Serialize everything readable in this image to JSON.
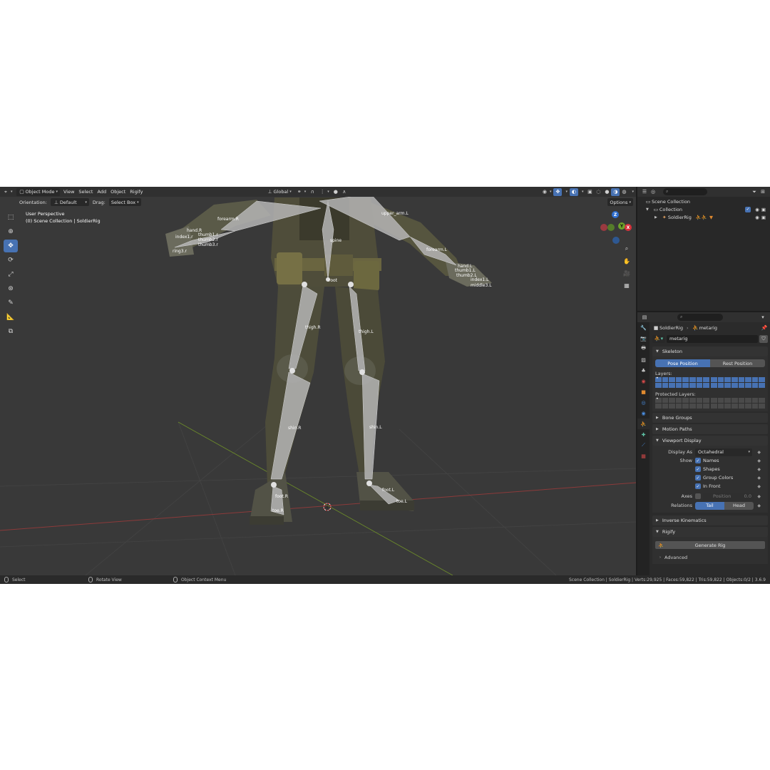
{
  "viewport": {
    "header": {
      "mode": "Object Mode",
      "menus": [
        "View",
        "Select",
        "Add",
        "Object",
        "Rigify"
      ],
      "transform_orientation": "Global"
    },
    "toolrow": {
      "orientation_label": "Orientation:",
      "orientation_value": "Default",
      "drag_label": "Drag:",
      "drag_value": "Select Box",
      "options_label": "Options"
    },
    "overlay": {
      "line1": "User Perspective",
      "line2": "(0) Scene Collection | SoldierRig"
    },
    "gizmo": {
      "z": "Z",
      "y": "Y",
      "x": "X"
    },
    "bone_labels": {
      "forearm_r": "forearm.R",
      "upper_arm_l": "upper_arm.L",
      "spine": "spine",
      "forearm_l": "forearm.L",
      "root": "root",
      "thigh_r": "thigh.R",
      "thigh_l": "thigh.L",
      "shin_r": "shin.R",
      "shin_l": "shin.L",
      "foot_r": "foot.R",
      "toe_r": "toe.R",
      "foot_l": "foot.L",
      "toe_l": "toe.L",
      "hand_r": "hand.R",
      "thumb1_r": "thumb1.r",
      "thumb2_r": "thumb2.r",
      "thumb3_r": "thumb3.r",
      "index_r": "index1.r",
      "ring_r": "ring3.r",
      "hand_l": "hand.L",
      "thumb1_l": "thumb1.L",
      "thumb2_l": "thumb2.L",
      "index_l": "index1.L",
      "middle_l": "middle3.L"
    }
  },
  "statusbar": {
    "select": "Select",
    "rotate": "Rotate View",
    "context": "Object Context Menu",
    "stats": "Scene Collection | SoldierRig | Verts:29,925 | Faces:59,822 | Tris:59,822 | Objects:0/2 | 3.6.9"
  },
  "outliner": {
    "scene_collection": "Scene Collection",
    "collection": "Collection",
    "object": "SoldierRig"
  },
  "properties": {
    "breadcrumb_object": "SoldierRig",
    "breadcrumb_data": "metarig",
    "datablock": "metarig",
    "skeleton": {
      "title": "Skeleton",
      "pose_position": "Pose Position",
      "rest_position": "Rest Position",
      "layers_label": "Layers:",
      "protected_label": "Protected Layers:"
    },
    "bone_groups": "Bone Groups",
    "motion_paths": "Motion Paths",
    "viewport_display": {
      "title": "Viewport Display",
      "display_as_label": "Display As",
      "display_as_value": "Octahedral",
      "show_label": "Show",
      "names": "Names",
      "shapes": "Shapes",
      "group_colors": "Group Colors",
      "in_front": "In Front",
      "axes_label": "Axes",
      "position_label": "Position",
      "position_value": "0.0",
      "relations_label": "Relations",
      "tail": "Tail",
      "head": "Head"
    },
    "inverse_kinematics": "Inverse Kinematics",
    "rigify": {
      "title": "Rigify",
      "generate": "Generate Rig",
      "advanced": "Advanced"
    }
  }
}
